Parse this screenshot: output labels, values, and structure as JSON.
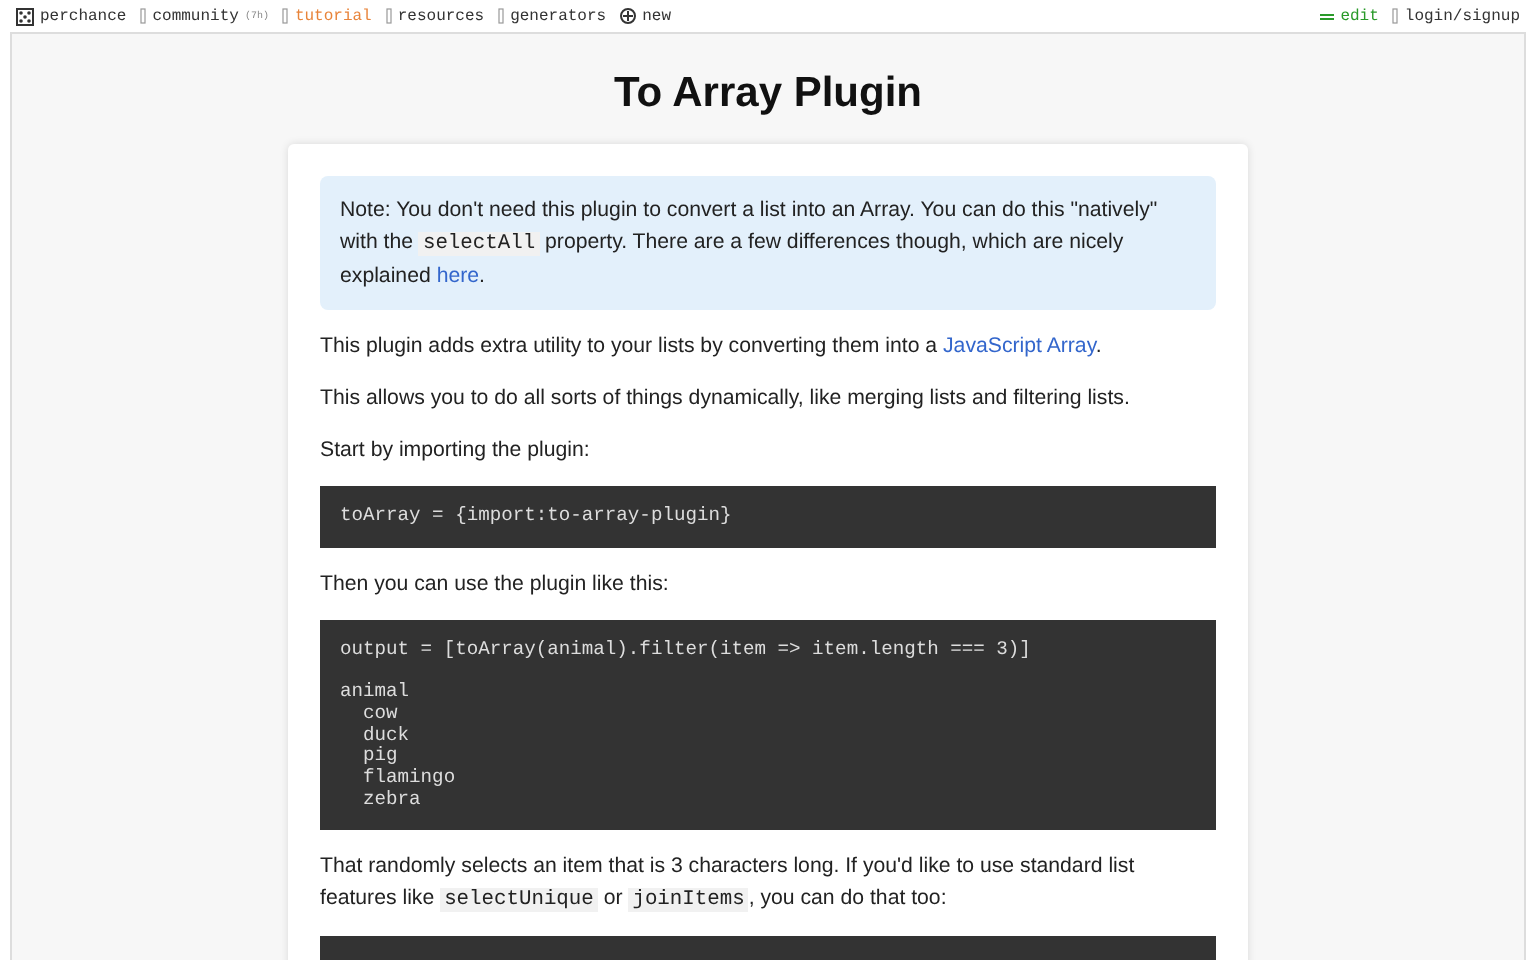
{
  "nav": {
    "left": [
      {
        "label": "perchance",
        "selected": false
      },
      {
        "label": "community",
        "badge": "(7h)",
        "selected": false
      },
      {
        "label": "tutorial",
        "selected": true
      },
      {
        "label": "resources",
        "selected": false
      },
      {
        "label": "generators",
        "selected": false
      },
      {
        "label": "new",
        "selected": false
      }
    ],
    "right": [
      {
        "label": "edit",
        "kind": "edit"
      },
      {
        "label": "login/signup",
        "kind": "plain"
      }
    ]
  },
  "title": "To Array Plugin",
  "content": [
    {
      "kind": "note",
      "segments": [
        {
          "kind": "text",
          "text": "Note: You don't need this plugin to convert a list into an Array. You can do this \"natively\" with the "
        },
        {
          "kind": "code",
          "text": "selectAll"
        },
        {
          "kind": "text",
          "text": " property. There are a few differences though, which are nicely explained "
        },
        {
          "kind": "link",
          "text": "here"
        },
        {
          "kind": "text",
          "text": "."
        }
      ]
    },
    {
      "kind": "paragraph",
      "segments": [
        {
          "kind": "text",
          "text": "This plugin adds extra utility to your lists by converting them into a "
        },
        {
          "kind": "link",
          "text": "JavaScript Array"
        },
        {
          "kind": "text",
          "text": "."
        }
      ]
    },
    {
      "kind": "paragraph",
      "segments": [
        {
          "kind": "text",
          "text": "This allows you to do all sorts of things dynamically, like merging lists and filtering lists."
        }
      ]
    },
    {
      "kind": "paragraph",
      "segments": [
        {
          "kind": "text",
          "text": "Start by importing the plugin:"
        }
      ]
    },
    {
      "kind": "code",
      "text": "toArray = {import:to-array-plugin}"
    },
    {
      "kind": "paragraph",
      "segments": [
        {
          "kind": "text",
          "text": "Then you can use the plugin like this:"
        }
      ]
    },
    {
      "kind": "code",
      "text": "output = [toArray(animal).filter(item => item.length === 3)]\n\nanimal\n  cow\n  duck\n  pig\n  flamingo\n  zebra"
    },
    {
      "kind": "paragraph",
      "segments": [
        {
          "kind": "text",
          "text": "That randomly selects an item that is 3 characters long. If you'd like to use standard list features like "
        },
        {
          "kind": "code",
          "text": "selectUnique"
        },
        {
          "kind": "text",
          "text": " or "
        },
        {
          "kind": "code",
          "text": "joinItems"
        },
        {
          "kind": "text",
          "text": ", you can do that too:"
        }
      ]
    },
    {
      "kind": "code"
    }
  ]
}
